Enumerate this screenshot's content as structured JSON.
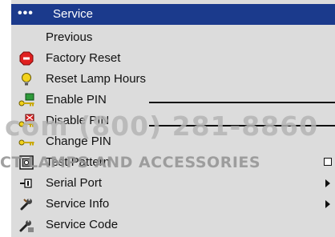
{
  "menu": {
    "header_dots": "•••",
    "title": "Service",
    "items": [
      {
        "label": "Previous",
        "icon": "none"
      },
      {
        "label": "Factory Reset",
        "icon": "stop-icon"
      },
      {
        "label": "Reset Lamp Hours",
        "icon": "lightbulb-icon"
      },
      {
        "label": "Enable PIN",
        "icon": "key-enable-icon"
      },
      {
        "label": "Disable PIN",
        "icon": "key-disable-icon"
      },
      {
        "label": "Change PIN",
        "icon": "key-change-icon"
      },
      {
        "label": "Test Pattern",
        "icon": "test-pattern-icon",
        "control": "checkbox"
      },
      {
        "label": "Serial Port",
        "icon": "serial-port-icon",
        "control": "submenu-arrow"
      },
      {
        "label": "Service Info",
        "icon": "wrench-icon",
        "control": "submenu-arrow"
      },
      {
        "label": "Service Code",
        "icon": "service-code-icon"
      }
    ]
  },
  "watermark": {
    "phone": "com (800) 281-8860",
    "store": "CT LAMPS AND ACCESSORIES"
  },
  "colors": {
    "header_bg": "#1b3a8c",
    "menu_bg": "#dcdcdc",
    "factory_reset_red": "#e02020",
    "bulb_yellow": "#f2d21c",
    "key_green": "#2e9a3a"
  }
}
